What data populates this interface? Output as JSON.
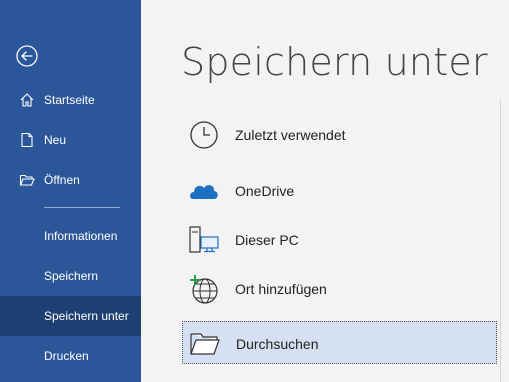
{
  "sidebar": {
    "back_label": "Zurück",
    "items": [
      {
        "label": "Startseite",
        "icon": "home-icon"
      },
      {
        "label": "Neu",
        "icon": "new-document-icon"
      },
      {
        "label": "Öffnen",
        "icon": "open-folder-icon"
      },
      {
        "label": "Informationen"
      },
      {
        "label": "Speichern"
      },
      {
        "label": "Speichern unter",
        "active": true
      },
      {
        "label": "Drucken"
      }
    ]
  },
  "main": {
    "title": "Speichern unter",
    "locations": [
      {
        "label": "Zuletzt verwendet",
        "icon": "clock-icon"
      },
      {
        "label": "OneDrive",
        "icon": "onedrive-cloud-icon"
      },
      {
        "label": "Dieser PC",
        "icon": "this-pc-icon"
      },
      {
        "label": "Ort hinzufügen",
        "icon": "add-location-globe-icon"
      },
      {
        "label": "Durchsuchen",
        "icon": "browse-folder-icon",
        "selected": true
      }
    ]
  },
  "colors": {
    "sidebar": "#2b579a",
    "sidebar_active": "#1e3f72",
    "selected_bg": "#d5e1f2"
  }
}
